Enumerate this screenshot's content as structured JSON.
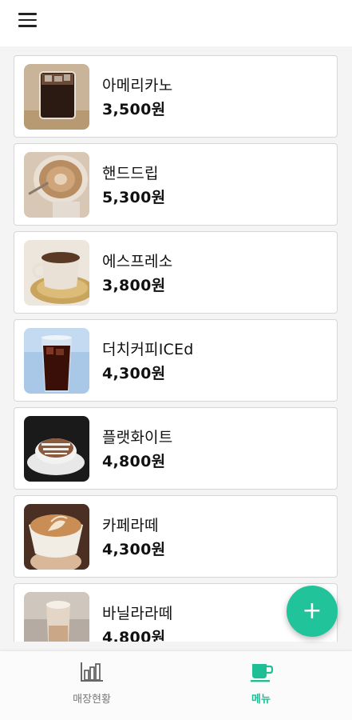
{
  "header": {
    "menu_icon": "hamburger-menu-icon"
  },
  "menu_items": [
    {
      "name": "아메리카노",
      "price": "3,500원",
      "image": "iced-americano-photo"
    },
    {
      "name": "핸드드립",
      "price": "5,300원",
      "image": "hand-drip-coffee-photo"
    },
    {
      "name": "에스프레소",
      "price": "3,800원",
      "image": "espresso-cup-photo"
    },
    {
      "name": "더치커피ICEd",
      "price": "4,300원",
      "image": "iced-dutch-coffee-photo"
    },
    {
      "name": "플랫화이트",
      "price": "4,800원",
      "image": "flat-white-photo"
    },
    {
      "name": "카페라떼",
      "price": "4,300원",
      "image": "cafe-latte-photo"
    },
    {
      "name": "바닐라라떼",
      "price": "4,800원",
      "image": "vanilla-latte-photo"
    }
  ],
  "fab": {
    "label": "+"
  },
  "bottom_nav": {
    "stats": {
      "label": "매장현황",
      "icon": "bar-chart-icon"
    },
    "menu": {
      "label": "메뉴",
      "icon": "coffee-cup-icon"
    }
  },
  "colors": {
    "accent": "#21c39a",
    "active_nav": "#1fbf96",
    "card_border": "#d6d6d6"
  }
}
